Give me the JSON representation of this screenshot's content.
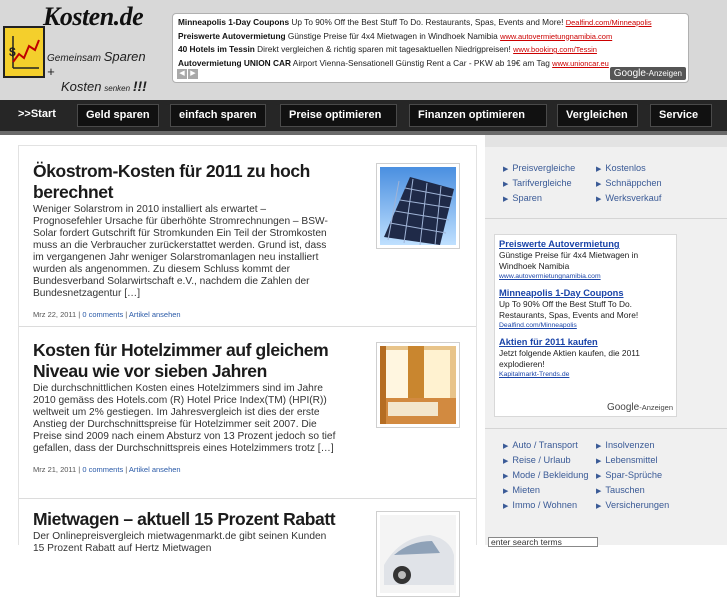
{
  "header": {
    "logo_title": "Kosten.de",
    "logo_sub1": "Gemeinsam",
    "logo_sub2": "Sparen +",
    "logo_sub3": "Kosten",
    "logo_sub4": "senken",
    "logo_sub5": "!!!"
  },
  "top_ads": {
    "items": [
      {
        "title": "Minneapolis 1-Day Coupons",
        "text": "Up To 90% Off the Best Stuff To Do. Restaurants, Spas, Events and More!",
        "url": "Dealfind.com/Minneapolis"
      },
      {
        "title": "Preiswerte Autovermietung",
        "text": "Günstige Preise für 4x4 Mietwagen in Windhoek Namibia",
        "url": "www.autovermietungnamibia.com"
      },
      {
        "title": "40 Hotels im Tessin",
        "text": "Direkt vergleichen & richtig sparen mit tagesaktuellen Niedrigpreisen!",
        "url": "www.booking.com/Tessin"
      },
      {
        "title": "Autovermietung UNION CAR",
        "text": "Airport Vienna-Sensationell Günstig Rent a Car - PKW ab 19€ am Tag",
        "url": "www.unioncar.eu"
      }
    ],
    "prev": "◀",
    "next": "▶",
    "google": "Google",
    "anzeigen": "-Anzeigen"
  },
  "nav": {
    "start": ">>Start",
    "items": [
      "Geld sparen",
      "einfach sparen",
      "Preise optimieren",
      "Finanzen optimieren",
      "Vergleichen",
      "Service"
    ]
  },
  "posts": [
    {
      "title": "Ökostrom-Kosten für 2011 zu hoch berechnet",
      "body": "Weniger Solarstrom in 2010 installiert als erwartet – Prognosefehler Ursache für überhöhte Stromrechnungen – BSW-Solar fordert Gutschrift für Stromkunden Ein Teil der Stromkosten muss an die Verbraucher zurückerstattet werden. Grund ist, dass im vergangenen Jahr weniger Solarstromanlagen neu installiert wurden als angenommen. Zu diesem Schluss kommt der Bundesverband Solarwirtschaft e.V., nachdem die Zahlen der Bundesnetzagentur […]",
      "date": "Mrz 22, 2011",
      "comments": "0 comments",
      "view": "Artikel ansehen"
    },
    {
      "title": "Kosten für Hotelzimmer auf gleichem Niveau wie vor sieben Jahren",
      "body": "Die durchschnittlichen Kosten eines Hotelzimmers sind im Jahre 2010 gemäss des Hotels.com (R) Hotel Price Index(TM) (HPI(R)) weltweit um 2% gestiegen. Im Jahresvergleich ist dies der erste Anstieg der Durchschnittspreise für Hotelzimmer seit 2007. Die Preise sind 2009 nach einem Absturz von 13 Prozent jedoch so tief gefallen, dass der Durchschnittspreis eines Hotelzimmers trotz […]",
      "date": "Mrz 21, 2011",
      "comments": "0 comments",
      "view": "Artikel ansehen"
    },
    {
      "title": "Mietwagen – aktuell 15 Prozent Rabatt",
      "body": "Der Onlinepreisvergleich mietwagenmarkt.de gibt seinen Kunden 15 Prozent Rabatt auf Hertz Mietwagen"
    }
  ],
  "sidebar": {
    "links1": [
      "Preisvergleiche",
      "Kostenlos",
      "Tarifvergleiche",
      "Schnäppchen",
      "Sparen",
      "Werksverkauf"
    ],
    "ads": [
      {
        "title": "Preiswerte Autovermietung",
        "text": "Günstige Preise für 4x4 Mietwagen in Windhoek Namibia",
        "url": "www.autovermietungnamibia.com"
      },
      {
        "title": "Minneapolis 1-Day Coupons",
        "text": "Up To 90% Off the Best Stuff To Do. Restaurants, Spas, Events and More!",
        "url": "Dealfind.com/Minneapolis"
      },
      {
        "title": "Aktien für 2011 kaufen",
        "text": "Jetzt folgende Aktien kaufen, die 2011 explodieren!",
        "url": "Kapitalmarkt-Trends.de"
      }
    ],
    "ad_google": "Google",
    "ad_anzeigen": "-Anzeigen",
    "links2": [
      "Auto / Transport",
      "Insolvenzen",
      "Reise / Urlaub",
      "Lebensmittel",
      "Mode / Bekleidung",
      "Spar-Sprüche",
      "Mieten",
      "Tauschen",
      "Immo / Wohnen",
      "Versicherungen"
    ],
    "search_placeholder": "enter search terms"
  },
  "colors": {
    "nav_bg": "#262626",
    "header_bg": "#d8d8d8",
    "link": "#3a5a96",
    "logo_yellow": "#f4cf2c"
  }
}
